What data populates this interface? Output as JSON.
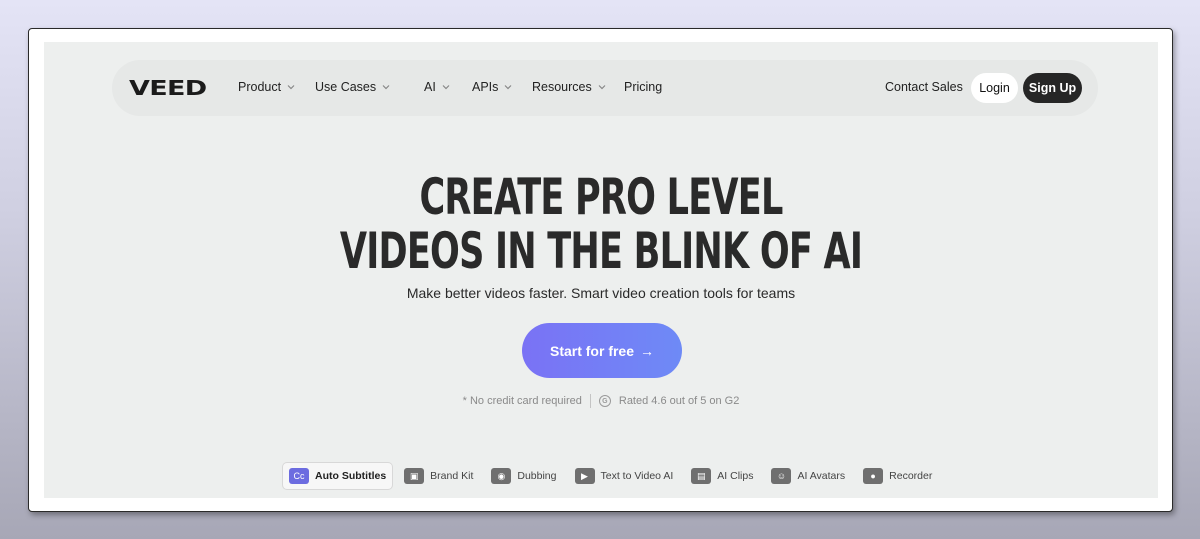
{
  "nav": {
    "logo": "VEED",
    "items": [
      {
        "label": "Product",
        "has_dropdown": true
      },
      {
        "label": "Use Cases",
        "has_dropdown": true
      },
      {
        "label": "AI",
        "has_dropdown": true
      },
      {
        "label": "APIs",
        "has_dropdown": true
      },
      {
        "label": "Resources",
        "has_dropdown": true
      },
      {
        "label": "Pricing",
        "has_dropdown": false
      }
    ],
    "contact_sales": "Contact Sales",
    "login": "Login",
    "signup": "Sign Up"
  },
  "hero": {
    "headline_line1": "CREATE PRO LEVEL",
    "headline_line2": "VIDEOS IN THE BLINK OF AI",
    "subtitle": "Make better videos faster. Smart video creation tools for teams",
    "cta_label": "Start for free",
    "cta_arrow": "→",
    "note": "* No credit card required",
    "rating": "Rated 4.6 out of 5 on G2",
    "rating_icon": "G"
  },
  "tools": [
    {
      "label": "Auto Subtitles",
      "icon": "cc-icon",
      "glyph": "Cc",
      "active": true
    },
    {
      "label": "Brand Kit",
      "icon": "brand-kit-icon",
      "glyph": "▣",
      "active": false
    },
    {
      "label": "Dubbing",
      "icon": "dubbing-icon",
      "glyph": "◉",
      "active": false
    },
    {
      "label": "Text to Video AI",
      "icon": "text-to-video-icon",
      "glyph": "▶",
      "active": false
    },
    {
      "label": "AI Clips",
      "icon": "ai-clips-icon",
      "glyph": "▤",
      "active": false
    },
    {
      "label": "AI Avatars",
      "icon": "ai-avatars-icon",
      "glyph": "☺",
      "active": false
    },
    {
      "label": "Recorder",
      "icon": "recorder-icon",
      "glyph": "●",
      "active": false
    }
  ],
  "colors": {
    "cta_start": "#7a72f5",
    "cta_end": "#6e8af6",
    "signup_bg": "#262626",
    "page_bg": "#edefee"
  }
}
